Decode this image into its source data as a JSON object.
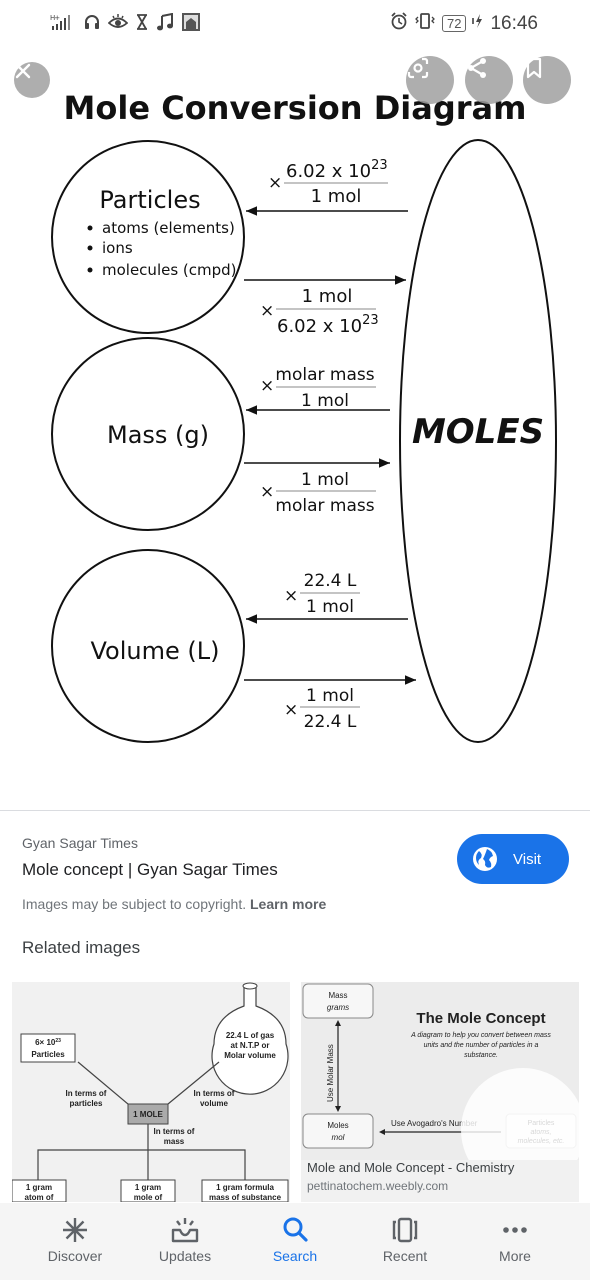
{
  "status_bar": {
    "signal_label": "H+",
    "battery_level": "72",
    "time": "16:46",
    "left_icons": [
      "signal-icon",
      "headphones-icon",
      "eye-icon",
      "hourglass-icon",
      "music-note-icon",
      "photo-app-icon"
    ],
    "right_icons": [
      "alarm-icon",
      "vibrate-icon",
      "battery-icon",
      "charging-icon"
    ]
  },
  "viewer": {
    "overlay_buttons": [
      "close",
      "lens",
      "share",
      "bookmark"
    ],
    "diagram": {
      "title": "Mole Conversion Diagram",
      "center_label": "MOLES",
      "nodes": [
        {
          "label": "Particles",
          "bullets": [
            "atoms (elements)",
            "ions",
            "molecules (cmpd)"
          ],
          "to_node": {
            "numerator": "6.02 x 10",
            "numerator_exp": "23",
            "denominator": "1 mol"
          },
          "to_moles": {
            "numerator": "1 mol",
            "denominator": "6.02 x 10",
            "denominator_exp": "23"
          }
        },
        {
          "label": "Mass (g)",
          "bullets": [],
          "to_node": {
            "numerator": "molar mass",
            "denominator": "1 mol"
          },
          "to_moles": {
            "numerator": "1 mol",
            "denominator": "molar mass"
          }
        },
        {
          "label": "Volume (L)",
          "bullets": [],
          "to_node": {
            "numerator": "22.4 L",
            "denominator": "1 mol"
          },
          "to_moles": {
            "numerator": "1 mol",
            "denominator": "22.4 L"
          }
        }
      ],
      "multiply_symbol": "×"
    }
  },
  "source": {
    "site_name": "Gyan Sagar Times",
    "page_title": "Mole concept | Gyan Sagar Times",
    "copyright_text": "Images may be subject to copyright.",
    "learn_more": "Learn more",
    "visit_label": "Visit",
    "accent_color": "#1a73e8"
  },
  "related": {
    "heading": "Related images",
    "items": [
      {
        "thumbnail": {
          "center": "1 MOLE",
          "particles_box": [
            "6× 10",
            "23",
            "Particles"
          ],
          "flask_text": [
            "22.4 L of gas",
            "at N.T.P or",
            "Molar volume"
          ],
          "edge_particles": [
            "In terms of",
            "particles"
          ],
          "edge_volume": [
            "In terms of",
            "volume"
          ],
          "edge_mass": [
            "In terms of",
            "mass"
          ],
          "bottom_boxes": [
            [
              "1 gram",
              "atom of"
            ],
            [
              "1 gram",
              "mole of"
            ],
            [
              "1 gram formula",
              "mass of substance"
            ]
          ]
        }
      },
      {
        "caption": "Mole and Mole Concept - Chemistry",
        "domain": "pettinatochem.weebly.com",
        "thumbnail": {
          "title": "The Mole Concept",
          "subtitle": [
            "A diagram to help you convert between mass",
            "units and the number of particles in a",
            "substance."
          ],
          "mass_box": [
            "Mass",
            "grams"
          ],
          "moles_box": [
            "Moles",
            "mol"
          ],
          "particles_box": [
            "Particles",
            "atoms,",
            "molecules, etc."
          ],
          "vertical_label": "Use Molar Mass",
          "horizontal_label": "Use Avogadro's Number"
        }
      }
    ]
  },
  "bottom_nav": {
    "items": [
      {
        "label": "Discover",
        "icon": "asterisk-icon",
        "active": false
      },
      {
        "label": "Updates",
        "icon": "updates-tray-icon",
        "active": false
      },
      {
        "label": "Search",
        "icon": "search-icon",
        "active": true
      },
      {
        "label": "Recent",
        "icon": "recent-cards-icon",
        "active": false
      },
      {
        "label": "More",
        "icon": "more-dots-icon",
        "active": false
      }
    ],
    "active_color": "#1a73e8"
  }
}
